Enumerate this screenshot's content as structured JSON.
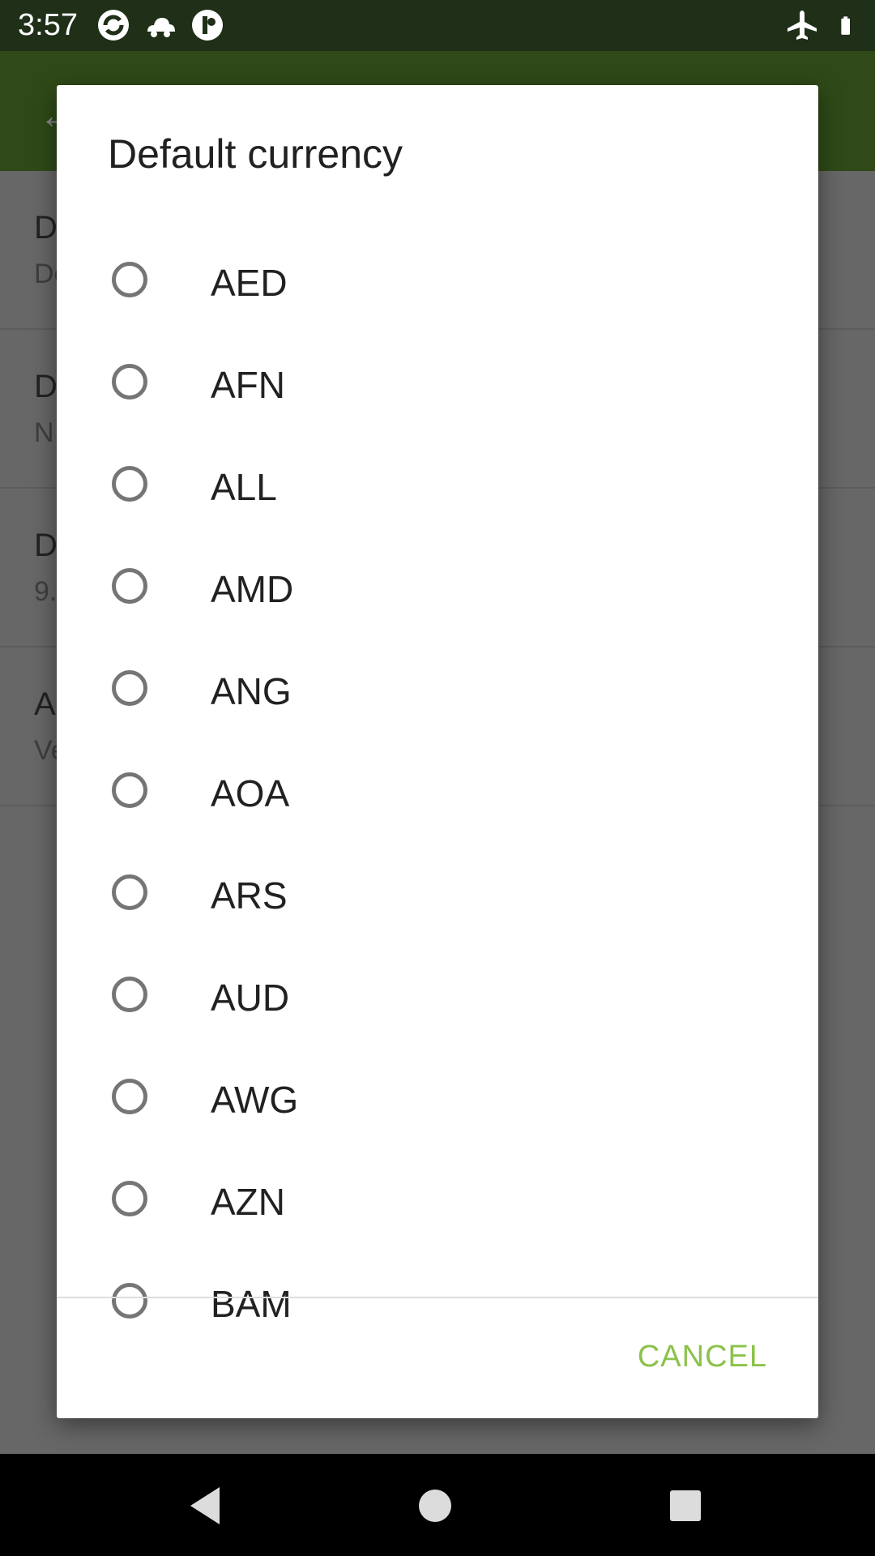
{
  "status_bar": {
    "time": "3:57",
    "left_icons": [
      "sync-icon",
      "cloud-icon",
      "circle-badge-icon"
    ],
    "right_icons": [
      "airplane-mode-icon",
      "battery-icon"
    ]
  },
  "background": {
    "rows": [
      {
        "title": "D",
        "subtitle": "De"
      },
      {
        "title": "D",
        "subtitle": "N"
      },
      {
        "title": "D",
        "subtitle": "9."
      },
      {
        "title": "A",
        "subtitle": "Ve"
      }
    ]
  },
  "dialog": {
    "title": "Default currency",
    "options": [
      "AED",
      "AFN",
      "ALL",
      "AMD",
      "ANG",
      "AOA",
      "ARS",
      "AUD",
      "AWG",
      "AZN",
      "BAM"
    ],
    "cancel_label": "CANCEL"
  },
  "colors": {
    "accent": "#8bc34a",
    "app_bar": "#4a7a22",
    "status_bar": "#1f2f18"
  }
}
